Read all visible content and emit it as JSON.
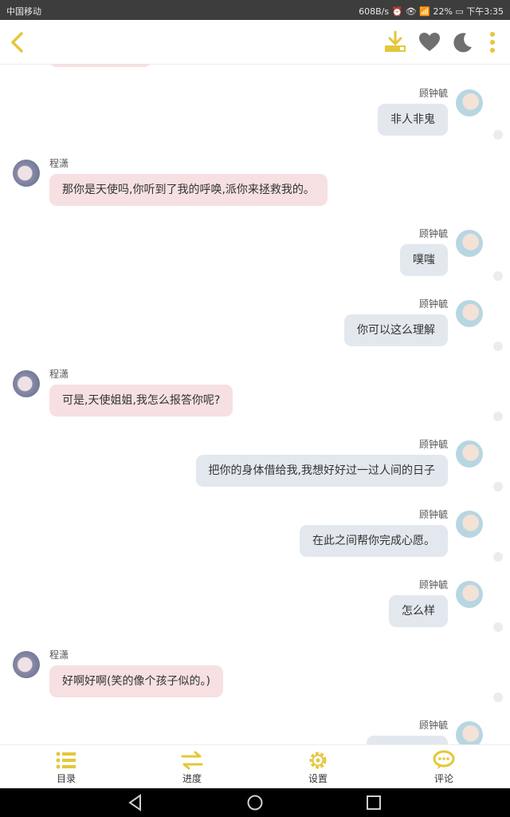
{
  "status_bar": {
    "carrier": "中国移动",
    "right": "608B/s ⏰ 👁 📶 22% ▭ 下午3:35"
  },
  "colors": {
    "accent": "#e4c73a",
    "icon_gray": "#6f6f6f",
    "bubble_right": "#e3e8ef",
    "bubble_left": "#f6e0e2"
  },
  "top_bar": {
    "icons": [
      "back-icon",
      "download-icon",
      "heart-icon",
      "moon-icon",
      "more-icon"
    ]
  },
  "messages": [
    {
      "name": "顾钟毓",
      "text": "非人非鬼"
    },
    {
      "name": "程潇",
      "text": "那你是天使吗,你听到了我的呼唤,派你来拯救我的。"
    },
    {
      "name": "顾钟毓",
      "text": "噗嗤"
    },
    {
      "name": "顾钟毓",
      "text": "你可以这么理解"
    },
    {
      "name": "程潇",
      "text": "可是,天使姐姐,我怎么报答你呢?"
    },
    {
      "name": "顾钟毓",
      "text": "把你的身体借给我,我想好好过一过人间的日子"
    },
    {
      "name": "顾钟毓",
      "text": "在此之间帮你完成心愿。"
    },
    {
      "name": "顾钟毓",
      "text": "怎么样"
    },
    {
      "name": "程潇",
      "text": "好啊好啊(笑的像个孩子似的。)"
    },
    {
      "name": "顾钟毓",
      "text": ""
    }
  ],
  "bottom_nav": [
    {
      "label": "目录",
      "icon": "list-icon"
    },
    {
      "label": "进度",
      "icon": "swap-icon"
    },
    {
      "label": "设置",
      "icon": "gear-icon"
    },
    {
      "label": "评论",
      "icon": "comment-icon"
    }
  ]
}
